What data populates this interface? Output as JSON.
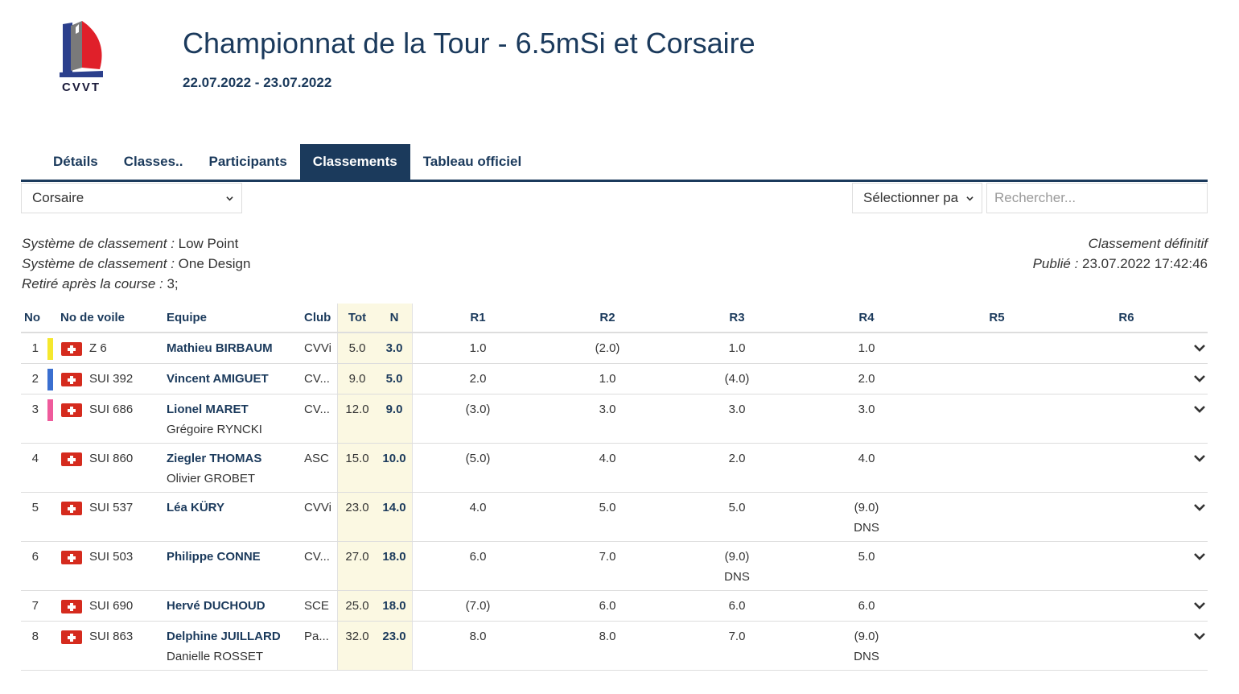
{
  "header": {
    "logo_text": "CVVT",
    "title": "Championnat de la Tour - 6.5mSi et Corsaire",
    "dates": "22.07.2022 - 23.07.2022"
  },
  "tabs": [
    {
      "label": "Détails",
      "active": false
    },
    {
      "label": "Classes..",
      "active": false
    },
    {
      "label": "Participants",
      "active": false
    },
    {
      "label": "Classements",
      "active": true
    },
    {
      "label": "Tableau officiel",
      "active": false
    }
  ],
  "controls": {
    "class_select": "Corsaire",
    "filter_select": "Sélectionner pa",
    "search_placeholder": "Rechercher..."
  },
  "info": {
    "system1_label": "Système de classement :",
    "system1_value": " Low Point",
    "system2_label": "Système de classement :",
    "system2_value": " One Design",
    "discard_label": "Retiré après la course :",
    "discard_value": " 3;",
    "status": "Classement définitif",
    "published_label": "Publié :",
    "published_value": " 23.07.2022 17:42:46"
  },
  "table": {
    "headers": {
      "no": "No",
      "sail": "No de voile",
      "team": "Equipe",
      "club": "Club",
      "tot": "Tot",
      "net": "N",
      "races": [
        "R1",
        "R2",
        "R3",
        "R4",
        "R5",
        "R6"
      ]
    },
    "rows": [
      {
        "rank": "1",
        "marker": "#f5e82e",
        "sail": "Z 6",
        "skipper": "Mathieu BIRBAUM",
        "crew": "",
        "club": "CVVi",
        "tot": "5.0",
        "net": "3.0",
        "races": [
          {
            "s": "1.0",
            "c": ""
          },
          {
            "s": "(2.0)",
            "c": ""
          },
          {
            "s": "1.0",
            "c": ""
          },
          {
            "s": "1.0",
            "c": ""
          },
          {
            "s": "",
            "c": ""
          },
          {
            "s": "",
            "c": ""
          }
        ]
      },
      {
        "rank": "2",
        "marker": "#3a6fd0",
        "sail": "SUI 392",
        "skipper": "Vincent AMIGUET",
        "crew": "",
        "club": "CV...",
        "tot": "9.0",
        "net": "5.0",
        "races": [
          {
            "s": "2.0",
            "c": ""
          },
          {
            "s": "1.0",
            "c": ""
          },
          {
            "s": "(4.0)",
            "c": ""
          },
          {
            "s": "2.0",
            "c": ""
          },
          {
            "s": "",
            "c": ""
          },
          {
            "s": "",
            "c": ""
          }
        ]
      },
      {
        "rank": "3",
        "marker": "#ef5b9c",
        "sail": "SUI 686",
        "skipper": "Lionel MARET",
        "crew": "Grégoire RYNCKI",
        "club": "CV...",
        "tot": "12.0",
        "net": "9.0",
        "races": [
          {
            "s": "(3.0)",
            "c": ""
          },
          {
            "s": "3.0",
            "c": ""
          },
          {
            "s": "3.0",
            "c": ""
          },
          {
            "s": "3.0",
            "c": ""
          },
          {
            "s": "",
            "c": ""
          },
          {
            "s": "",
            "c": ""
          }
        ]
      },
      {
        "rank": "4",
        "marker": "",
        "sail": "SUI 860",
        "skipper": "Ziegler THOMAS",
        "crew": "Olivier GROBET",
        "club": "ASC",
        "tot": "15.0",
        "net": "10.0",
        "races": [
          {
            "s": "(5.0)",
            "c": ""
          },
          {
            "s": "4.0",
            "c": ""
          },
          {
            "s": "2.0",
            "c": ""
          },
          {
            "s": "4.0",
            "c": ""
          },
          {
            "s": "",
            "c": ""
          },
          {
            "s": "",
            "c": ""
          }
        ]
      },
      {
        "rank": "5",
        "marker": "",
        "sail": "SUI 537",
        "skipper": "Léa KÜRY",
        "crew": "",
        "club": "CVVi",
        "tot": "23.0",
        "net": "14.0",
        "races": [
          {
            "s": "4.0",
            "c": ""
          },
          {
            "s": "5.0",
            "c": ""
          },
          {
            "s": "5.0",
            "c": ""
          },
          {
            "s": "(9.0)",
            "c": "DNS"
          },
          {
            "s": "",
            "c": ""
          },
          {
            "s": "",
            "c": ""
          }
        ]
      },
      {
        "rank": "6",
        "marker": "",
        "sail": "SUI 503",
        "skipper": "Philippe CONNE",
        "crew": "",
        "club": "CV...",
        "tot": "27.0",
        "net": "18.0",
        "races": [
          {
            "s": "6.0",
            "c": ""
          },
          {
            "s": "7.0",
            "c": ""
          },
          {
            "s": "(9.0)",
            "c": "DNS"
          },
          {
            "s": "5.0",
            "c": ""
          },
          {
            "s": "",
            "c": ""
          },
          {
            "s": "",
            "c": ""
          }
        ]
      },
      {
        "rank": "7",
        "marker": "",
        "sail": "SUI 690",
        "skipper": "Hervé DUCHOUD",
        "crew": "",
        "club": "SCE",
        "tot": "25.0",
        "net": "18.0",
        "races": [
          {
            "s": "(7.0)",
            "c": ""
          },
          {
            "s": "6.0",
            "c": ""
          },
          {
            "s": "6.0",
            "c": ""
          },
          {
            "s": "6.0",
            "c": ""
          },
          {
            "s": "",
            "c": ""
          },
          {
            "s": "",
            "c": ""
          }
        ]
      },
      {
        "rank": "8",
        "marker": "",
        "sail": "SUI 863",
        "skipper": "Delphine JUILLARD",
        "crew": "Danielle ROSSET",
        "club": "Pa...",
        "tot": "32.0",
        "net": "23.0",
        "races": [
          {
            "s": "8.0",
            "c": ""
          },
          {
            "s": "8.0",
            "c": ""
          },
          {
            "s": "7.0",
            "c": ""
          },
          {
            "s": "(9.0)",
            "c": "DNS"
          },
          {
            "s": "",
            "c": ""
          },
          {
            "s": "",
            "c": ""
          }
        ]
      }
    ]
  },
  "colors": {
    "primary": "#1b3a5c",
    "tot_band": "#fbf8e2",
    "flag_red": "#d52b1e"
  }
}
